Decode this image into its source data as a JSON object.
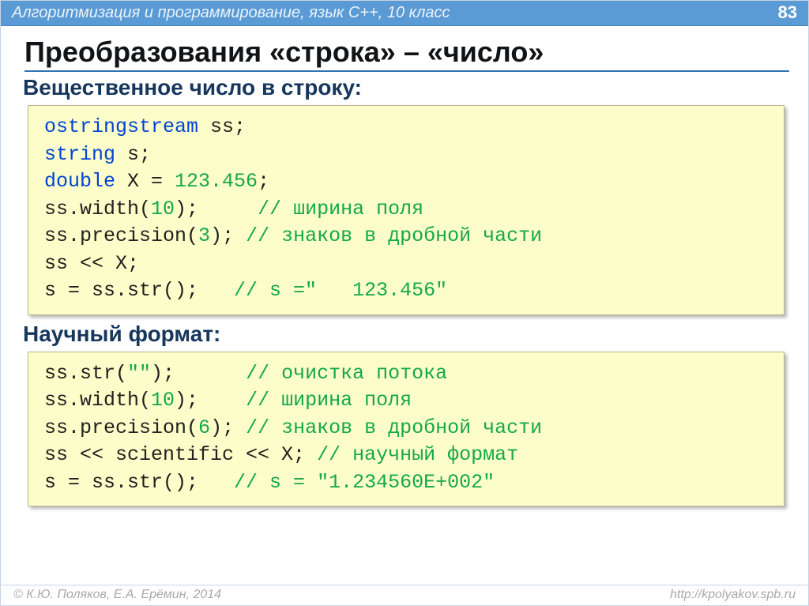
{
  "header": {
    "course": "Алгоритмизация и программирование, язык C++, 10 класс",
    "page": "83"
  },
  "title": "Преобразования «строка» – «число»",
  "section1": {
    "label": "Вещественное число в строку:",
    "code": {
      "l1_kw": "ostringstream",
      "l1_rest": " ss;",
      "l2_kw": "string",
      "l2_rest": " s;",
      "l3_kw": "double",
      "l3_mid": " X = ",
      "l3_num": "123.456",
      "l3_end": ";",
      "l4_a": "ss.width(",
      "l4_num": "10",
      "l4_b": ");     ",
      "l4_com": "// ширина поля",
      "l5_a": "ss.precision(",
      "l5_num": "3",
      "l5_b": "); ",
      "l5_com": "// знаков в дробной части",
      "l6": "ss << X;",
      "l7_a": "s = ss.str();   ",
      "l7_com": "// s =\"   123.456\""
    }
  },
  "section2": {
    "label": "Научный формат:",
    "code": {
      "l1_a": "ss.str(",
      "l1_str": "\"\"",
      "l1_b": ");      ",
      "l1_com": "// очистка потока",
      "l2_a": "ss.width(",
      "l2_num": "10",
      "l2_b": ");    ",
      "l2_com": "// ширина поля",
      "l3_a": "ss.precision(",
      "l3_num": "6",
      "l3_b": "); ",
      "l3_com": "// знаков в дробной части",
      "l4_a": "ss << scientific << X; ",
      "l4_com": "// научный формат",
      "l5_a": "s = ss.str();   ",
      "l5_com": "// s = \"1.234560E+002\""
    }
  },
  "footer": {
    "authors": "© К.Ю. Поляков, Е.А. Ерёмин, 2014",
    "url": "http://kpolyakov.spb.ru"
  }
}
